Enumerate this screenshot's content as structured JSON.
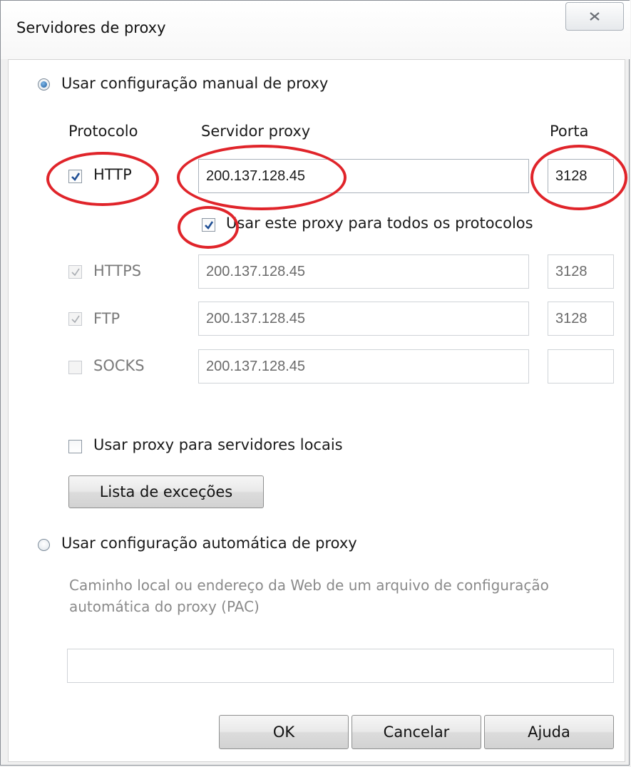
{
  "window": {
    "title": "Servidores de proxy",
    "close_icon": "close-icon"
  },
  "manual": {
    "radio_label": "Usar configuração manual de proxy",
    "selected": true,
    "headers": {
      "protocol": "Protocolo",
      "server": "Servidor proxy",
      "port": "Porta"
    },
    "rows": [
      {
        "protocol": "HTTP",
        "checked": true,
        "enabled": true,
        "server": "200.137.128.45",
        "port": "3128"
      },
      {
        "protocol": "HTTPS",
        "checked": true,
        "enabled": false,
        "server": "200.137.128.45",
        "port": "3128"
      },
      {
        "protocol": "FTP",
        "checked": true,
        "enabled": false,
        "server": "200.137.128.45",
        "port": "3128"
      },
      {
        "protocol": "SOCKS",
        "checked": false,
        "enabled": false,
        "server": "200.137.128.45",
        "port": ""
      }
    ],
    "use_for_all_label": "Usar este proxy para todos os protocolos",
    "use_for_all_checked": true,
    "local_proxy_label": "Usar proxy para servidores locais",
    "local_proxy_checked": false,
    "exceptions_button": "Lista de exceções"
  },
  "automatic": {
    "radio_label": "Usar configuração automática de proxy",
    "selected": false,
    "hint": "Caminho local ou endereço da Web de um arquivo de configuração automática do proxy (PAC)",
    "pac_value": ""
  },
  "buttons": {
    "ok": "OK",
    "cancel": "Cancelar",
    "help": "Ajuda"
  },
  "colors": {
    "annotation_red": "#e0242a",
    "check_blue": "#1f4f95"
  }
}
